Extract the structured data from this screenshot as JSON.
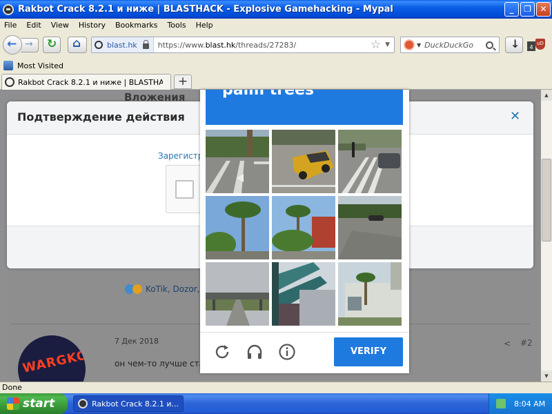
{
  "window": {
    "title": "Rakbot Crack 8.2.1 и ниже | BLASTHACK - Explosive Gamehacking - Mypal"
  },
  "menu": {
    "items": [
      "File",
      "Edit",
      "View",
      "History",
      "Bookmarks",
      "Tools",
      "Help"
    ]
  },
  "nav": {
    "identity": "blast.hk",
    "url_prefix": "https://www.",
    "url_domain": "blast.hk",
    "url_path": "/threads/27283/",
    "search_placeholder": "DuckDuckGo",
    "addon_badge": "4"
  },
  "bookmarks": {
    "most_visited": "Most Visited"
  },
  "tab": {
    "label": "Rakbot Crack 8.2.1 и ниже | BLASTHACK - E...",
    "new_tab": "+"
  },
  "page": {
    "attachments_heading": "Вложения",
    "reactions": "KoTik, Dozor, p",
    "post_date": "7 Дек 2018",
    "post_text": "он чем-то лучше стар",
    "post_number": "#2",
    "avatar_text": "WARGKO"
  },
  "dialog": {
    "title": "Подтверждение действия",
    "link_text": "Зарегистри"
  },
  "captcha": {
    "banner_text": "palm trees",
    "verify_label": "VERIFY",
    "tiles": [
      "street-crosswalk",
      "taxi-van-street",
      "crosswalk-car",
      "palm-trees-street",
      "palm-trees-buildings",
      "car-road",
      "highway-overpass",
      "outdoor-staircase",
      "building-palm-trees"
    ]
  },
  "status": {
    "text": "Done"
  },
  "taskbar": {
    "start_label": "start",
    "task_label": "Rakbot Crack 8.2.1 и...",
    "clock": "8:04 AM"
  },
  "colors": {
    "captcha_blue": "#1f7ae0",
    "link_blue": "#2577b1",
    "xp_title_blue": "#0b5ee6"
  }
}
